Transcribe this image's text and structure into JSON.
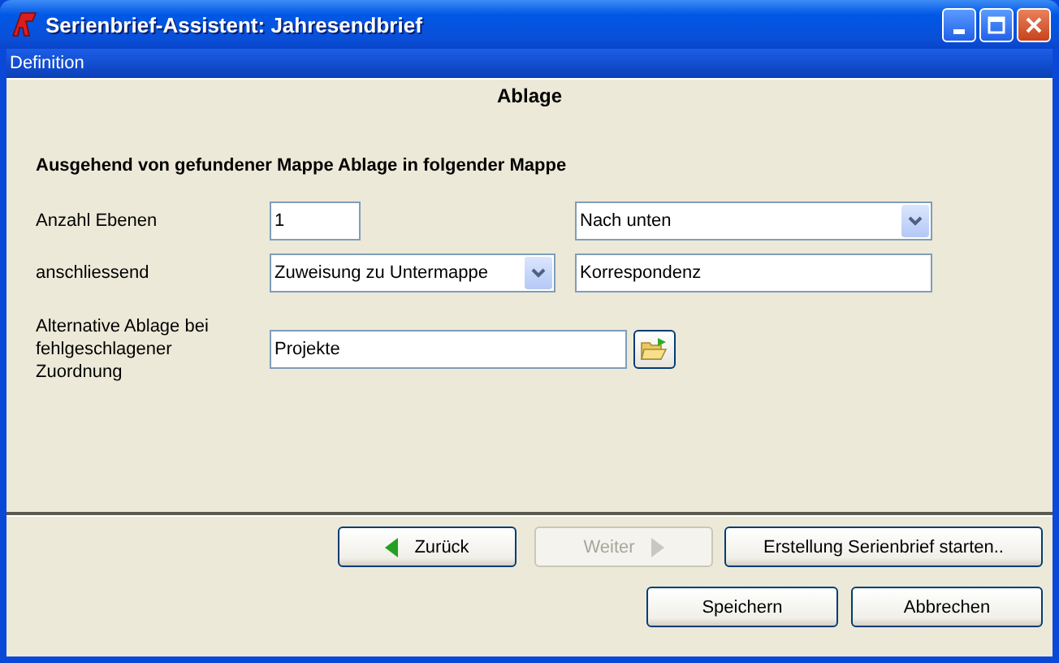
{
  "window": {
    "title": "Serienbrief-Assistent: Jahresendbrief"
  },
  "menu": [
    "Definition"
  ],
  "section_title": "Ablage",
  "heading": "Ausgehend von gefundener Mappe Ablage in folgender Mappe",
  "rows": [
    {
      "label": "Anzahl Ebenen",
      "controls": [
        {
          "kind": "text",
          "value": "1"
        },
        {
          "kind": "dropdown",
          "value": "Nach unten"
        }
      ]
    },
    {
      "label": "anschliessend",
      "controls": [
        {
          "kind": "dropdown",
          "value": "Zuweisung zu Untermappe"
        },
        {
          "kind": "text",
          "value": "Korrespondenz"
        }
      ]
    },
    {
      "label": "Alternative Ablage bei fehlgeschlagener Zuordnung",
      "controls": [
        {
          "kind": "text",
          "value": "Projekte"
        },
        {
          "kind": "folder-button"
        }
      ]
    }
  ],
  "nav_buttons": [
    {
      "label": "Zurück",
      "kind": "back",
      "disabled": false
    },
    {
      "label": "Weiter",
      "kind": "next",
      "disabled": true
    },
    {
      "label": "Erstellung Serienbrief starten..",
      "kind": "plain",
      "disabled": false
    }
  ],
  "buttons": [
    {
      "label": "Speichern",
      "disabled": false
    },
    {
      "label": "Abbrechen",
      "disabled": false
    }
  ]
}
